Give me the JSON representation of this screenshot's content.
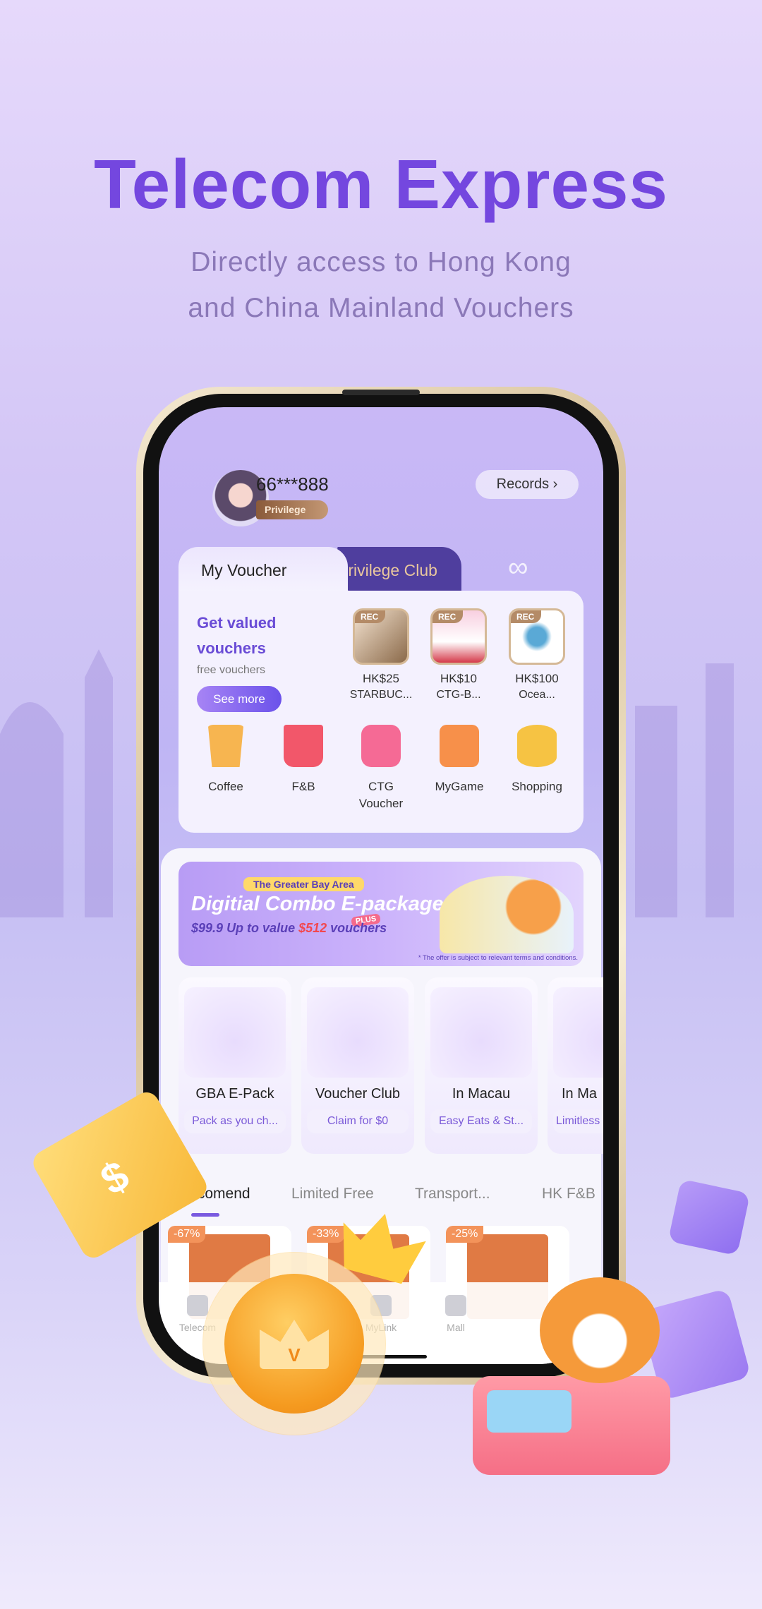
{
  "hero": {
    "title": "Telecom Express",
    "subtitle_line1": "Directly access to Hong Kong",
    "subtitle_line2": "and China Mainland Vouchers"
  },
  "profile": {
    "user_id": "66***888",
    "badge": "Privilege",
    "records_label": "Records ›"
  },
  "tabs": {
    "my_voucher": "My Voucher",
    "privilege_club": "Privilege Club"
  },
  "voucher_card": {
    "headline_line1": "Get valued",
    "headline_line2": "vouchers",
    "subtext": "free vouchers",
    "see_more": "See more",
    "recommended": [
      {
        "tag": "REC",
        "price": "HK$25",
        "name": "STARBUC..."
      },
      {
        "tag": "REC",
        "price": "HK$10",
        "name": "CTG-B..."
      },
      {
        "tag": "REC",
        "price": "HK$100",
        "name": "Ocea..."
      }
    ],
    "categories": [
      {
        "label": "Coffee",
        "icon": "coffee-cup-icon",
        "color": "#f7b550"
      },
      {
        "label": "F&B",
        "icon": "basket-icon",
        "color": "#f2576a"
      },
      {
        "label": "CTG\nVoucher",
        "icon": "bus-icon",
        "color": "#f56a95"
      },
      {
        "label": "MyGame",
        "icon": "gift-icon",
        "color": "#f7904a"
      },
      {
        "label": "Shopping",
        "icon": "coins-icon",
        "color": "#f6c343"
      }
    ]
  },
  "banner": {
    "tag": "The Greater Bay Area",
    "title": "Digitial Combo E-package",
    "plus": "PLUS",
    "price": "$99.9",
    "price_text": "Up to value",
    "value": "$512",
    "value_suffix": "vouchers",
    "note": "* The offer is subject to relevant terms and conditions."
  },
  "features": [
    {
      "title": "GBA E-Pack",
      "subtitle": "Pack as you ch..."
    },
    {
      "title": "Voucher Club",
      "subtitle": "Claim for $0"
    },
    {
      "title": "In Macau",
      "subtitle": "Easy Eats & St..."
    },
    {
      "title": "In Ma",
      "subtitle": "Limitless"
    }
  ],
  "category_tabs": [
    "Recomend",
    "Limited Free",
    "Transport...",
    "HK F&B"
  ],
  "products": [
    {
      "discount": "-67%"
    },
    {
      "discount": "-33%"
    },
    {
      "discount": "-25%"
    }
  ],
  "bottom_nav": [
    "Telecom",
    "",
    "MyLink",
    "Mall"
  ],
  "badge_v": "V",
  "colors": {
    "title": "#7447df",
    "accent": "#6b52ea",
    "privilege_tab": "#4f3e9e",
    "orange": "#f59a1f"
  }
}
